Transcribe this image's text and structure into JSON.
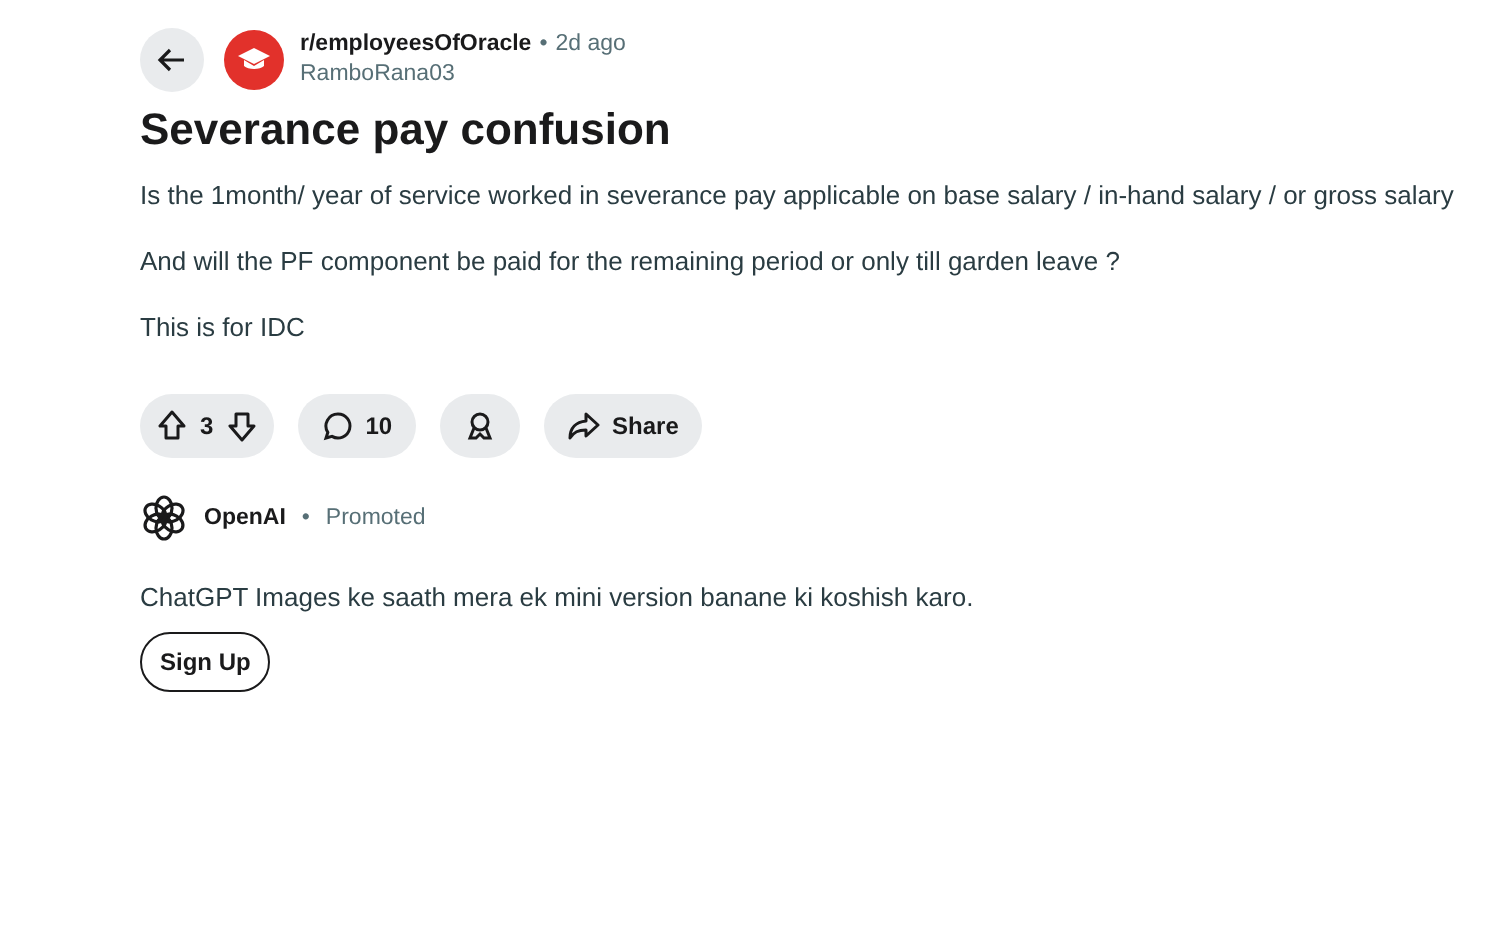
{
  "post": {
    "community": "r/employeesOfOracle",
    "separator": "•",
    "time": "2d ago",
    "author": "RamboRana03",
    "title": "Severance pay confusion",
    "paragraphs": [
      "Is the 1month/ year of service worked in severance pay applicable on base salary / in-hand salary / or gross salary",
      "And will the PF component be paid for the remaining period or only till garden leave ?",
      "This is for IDC"
    ],
    "votes": "3",
    "comments": "10",
    "share": "Share"
  },
  "ad": {
    "advertiser": "OpenAI",
    "separator": "•",
    "label": "Promoted",
    "text": "ChatGPT Images ke saath mera ek mini version banane ki koshish karo.",
    "button": "Sign Up"
  }
}
